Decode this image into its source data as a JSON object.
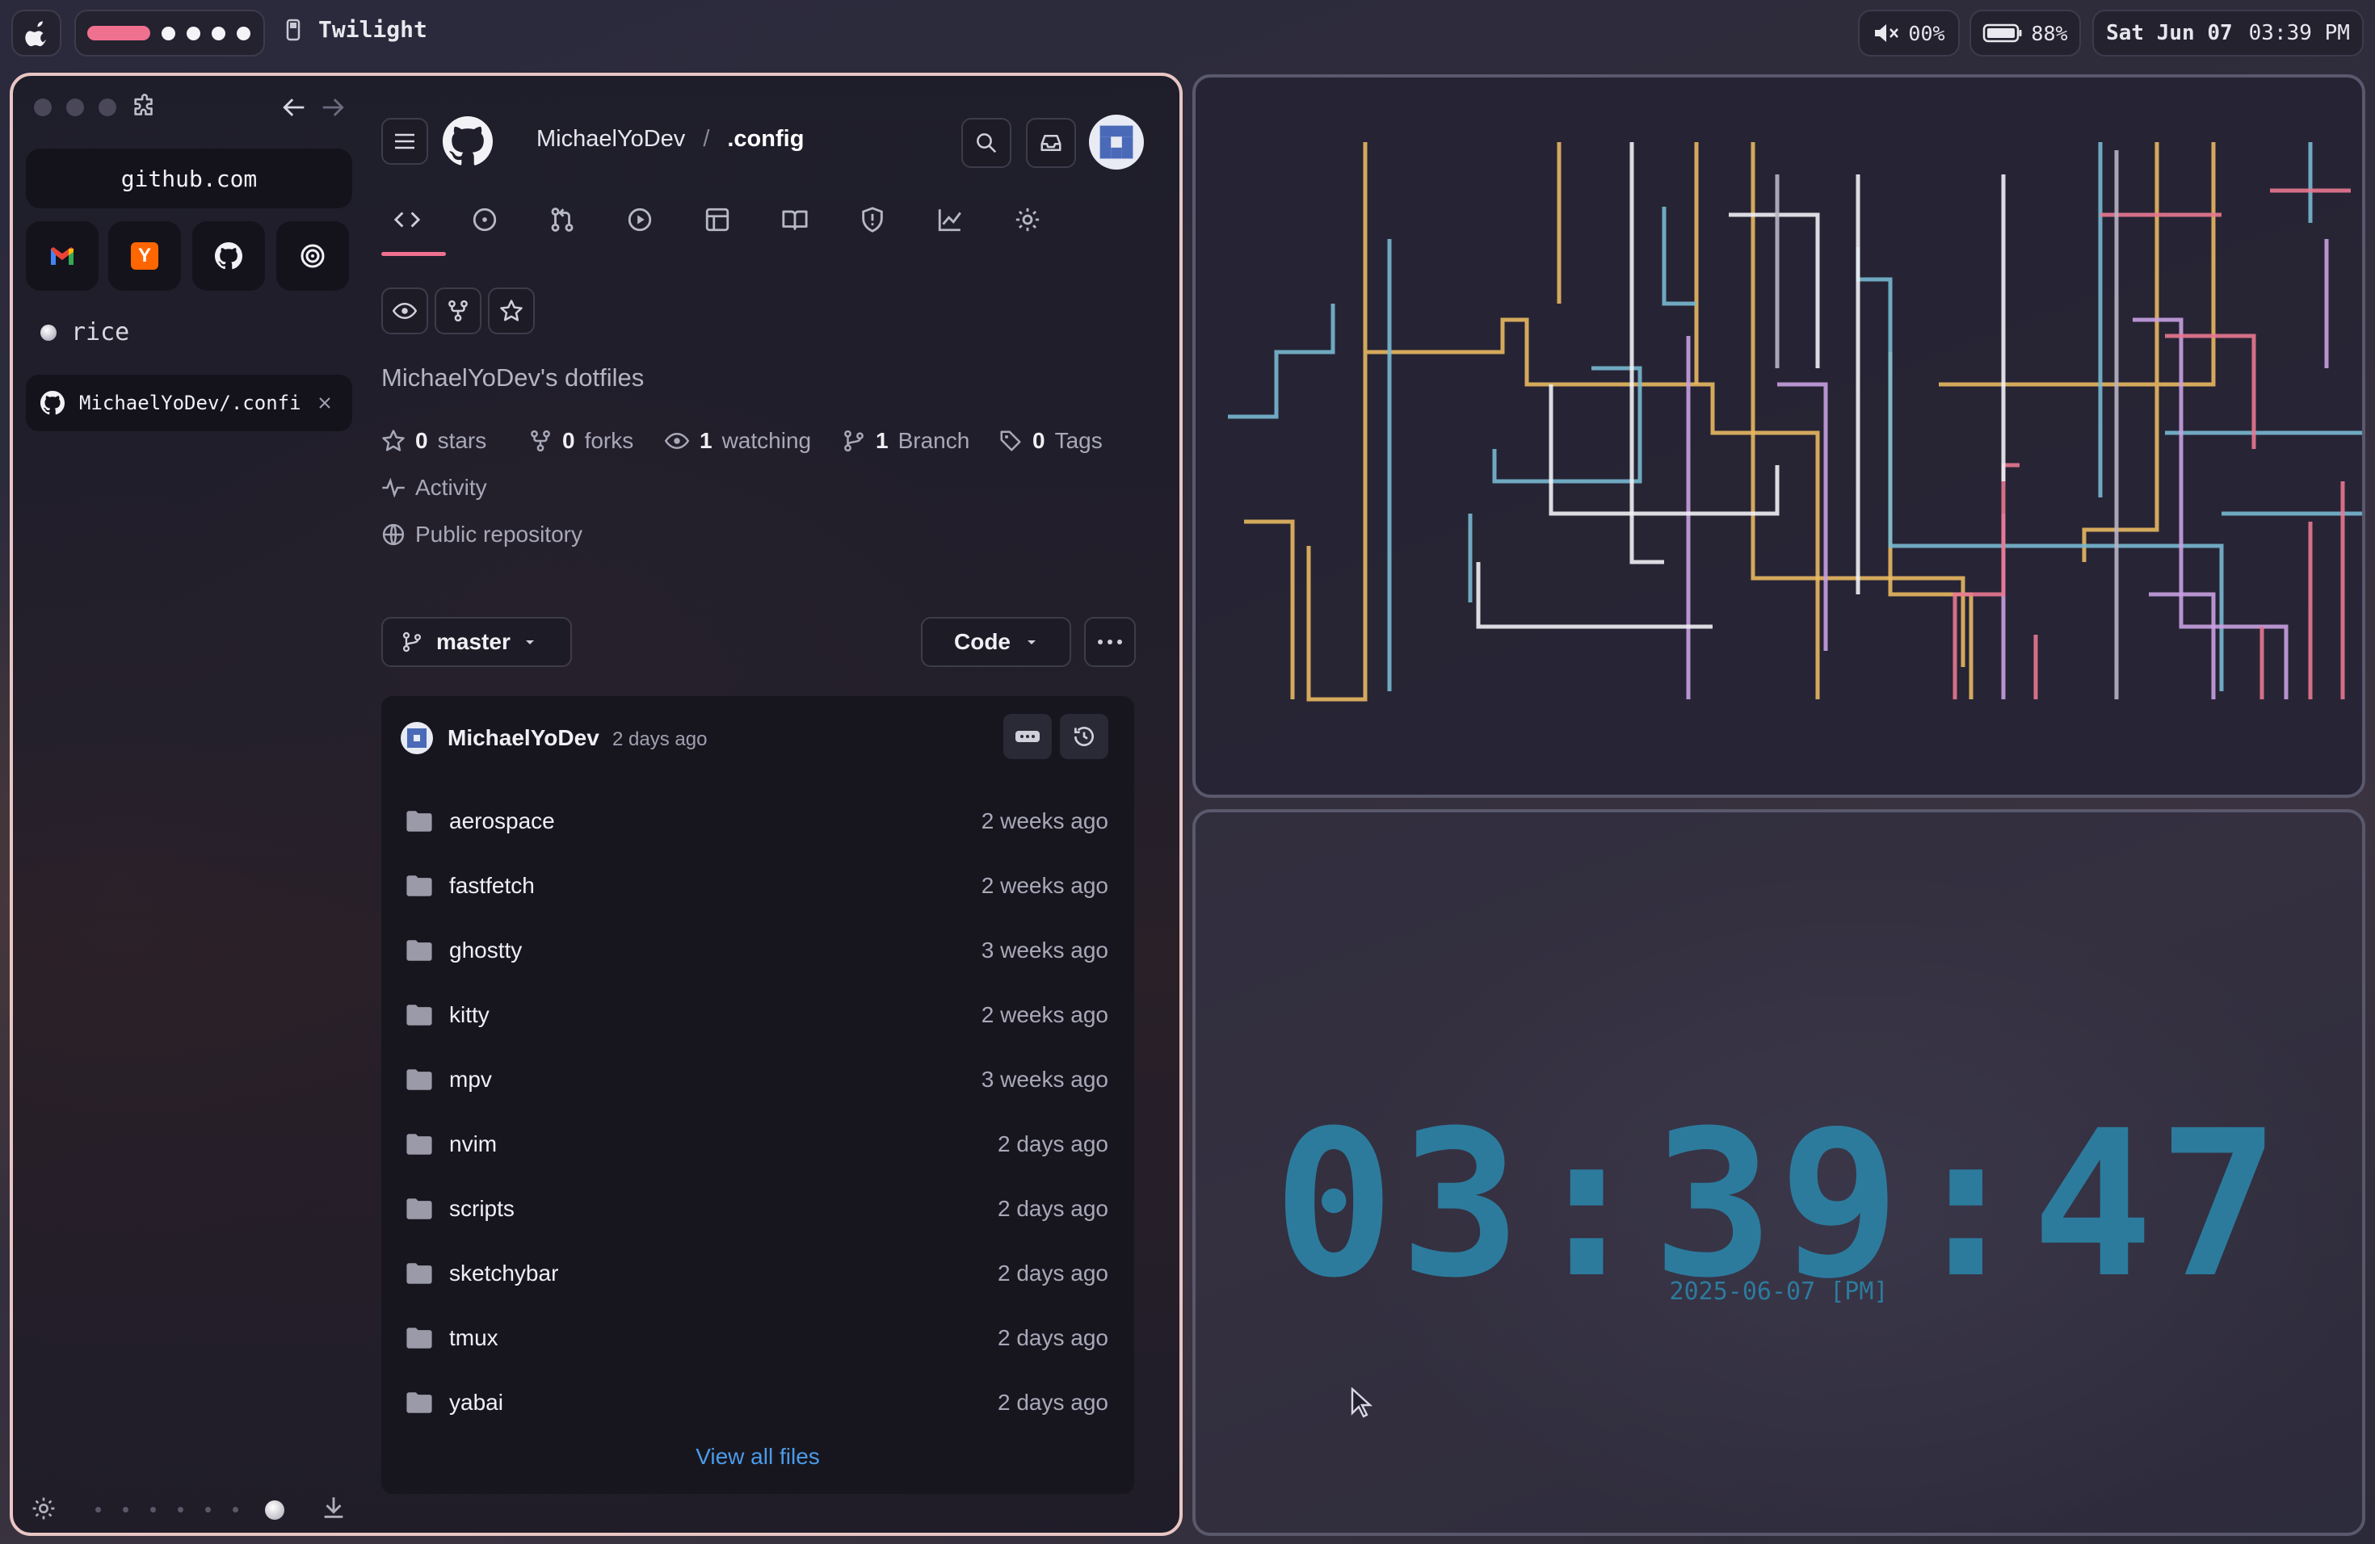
{
  "topbar": {
    "app_name": "Twilight",
    "volume": "00%",
    "battery": "88%",
    "date": "Sat Jun 07",
    "time": "03:39 PM"
  },
  "sidebar": {
    "url": "github.com",
    "favorites": [
      "gmail-icon",
      "hacker-news-icon",
      "github-icon",
      "openai-icon"
    ],
    "hn_letter": "Y",
    "space_label": "rice",
    "tab_label": "MichaelYoDev/.config"
  },
  "repo": {
    "owner": "MichaelYoDev",
    "separator": "/",
    "name": ".config",
    "description": "MichaelYoDev's dotfiles",
    "stars_count": "0",
    "stars_label": "stars",
    "forks_count": "0",
    "forks_label": "forks",
    "watching_count": "1",
    "watching_label": "watching",
    "branch_count": "1",
    "branch_label": "Branch",
    "tags_count": "0",
    "tags_label": "Tags",
    "activity_label": "Activity",
    "visibility_label": "Public repository",
    "branch_name": "master",
    "code_button": "Code",
    "commit_author": "MichaelYoDev",
    "commit_time": "2 days ago",
    "files": [
      {
        "name": "aerospace",
        "date": "2 weeks ago"
      },
      {
        "name": "fastfetch",
        "date": "2 weeks ago"
      },
      {
        "name": "ghostty",
        "date": "3 weeks ago"
      },
      {
        "name": "kitty",
        "date": "2 weeks ago"
      },
      {
        "name": "mpv",
        "date": "3 weeks ago"
      },
      {
        "name": "nvim",
        "date": "2 days ago"
      },
      {
        "name": "scripts",
        "date": "2 days ago"
      },
      {
        "name": "sketchybar",
        "date": "2 days ago"
      },
      {
        "name": "tmux",
        "date": "2 days ago"
      },
      {
        "name": "yabai",
        "date": "2 days ago"
      }
    ],
    "view_all": "View all files"
  },
  "clock": {
    "time": "03:39:47",
    "date": "2025-06-07 [PM]"
  },
  "colors": {
    "accent_pink": "#f07090",
    "clock_blue": "#2c7b9d",
    "link_blue": "#4c9be8",
    "window_border": "#e9c6c4"
  }
}
